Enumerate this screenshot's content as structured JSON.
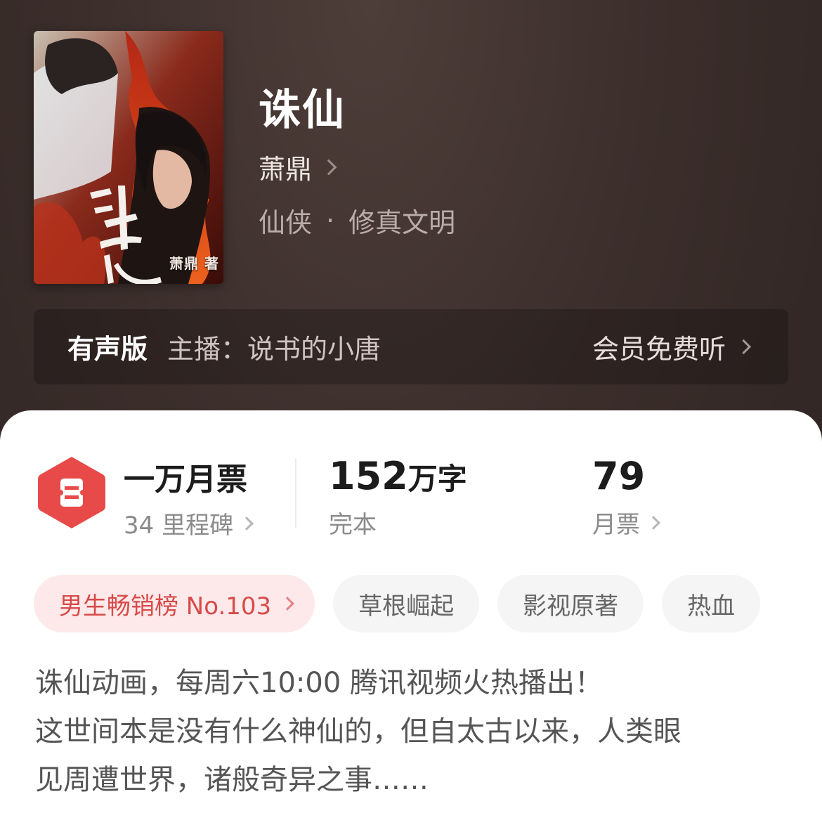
{
  "book": {
    "title": "诛仙",
    "author": "萧鼎",
    "genre": "仙侠",
    "subgenre": "修真文明",
    "separator": "·",
    "cover": {
      "author_credit": "萧鼎 著",
      "icon": "book-cover-illustration"
    }
  },
  "audio": {
    "label": "有声版",
    "host": "主播：说书的小唐",
    "cta": "会员免费听"
  },
  "stats": {
    "tickets": {
      "main": "一万月票",
      "sub": "34 里程碑",
      "icon": "ticket-icon",
      "color": "#e84a4a"
    },
    "words": {
      "number": "152",
      "unit": "万字",
      "status": "完本"
    },
    "monthly": {
      "value": "79",
      "label": "月票"
    }
  },
  "tags": [
    {
      "label": "男生畅销榜 No.103",
      "highlight": true
    },
    {
      "label": "草根崛起"
    },
    {
      "label": "影视原著"
    },
    {
      "label": "热血"
    }
  ],
  "description": [
    "诛仙动画，每周六10:00 腾讯视频火热播出！",
    "这世间本是没有什么神仙的，但自太古以来，人类眼",
    "见周遭世界，诸般奇异之事……"
  ],
  "colors": {
    "accent": "#e84a4a",
    "header_bg": "#3b2e2b"
  }
}
